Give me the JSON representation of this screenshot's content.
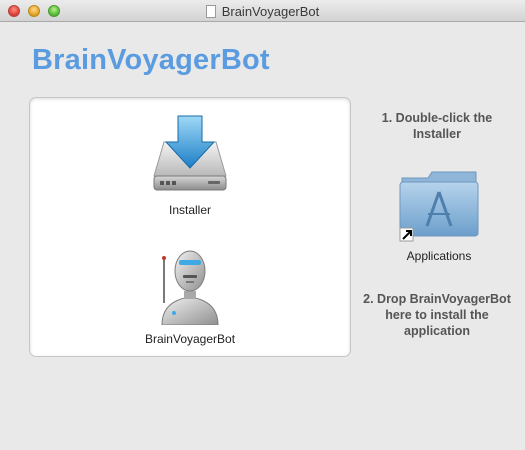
{
  "window": {
    "title": "BrainVoyagerBot"
  },
  "heading": "BrainVoyagerBot",
  "panel": {
    "items": [
      {
        "label": "Installer",
        "icon": "installer-drive-icon"
      },
      {
        "label": "BrainVoyagerBot",
        "icon": "robot-icon"
      }
    ]
  },
  "instructions": {
    "step1": "1. Double-click the Installer",
    "step2": "2. Drop BrainVoyagerBot here to install the application"
  },
  "applications": {
    "label": "Applications",
    "icon": "applications-folder-icon"
  },
  "colors": {
    "heading": "#5b9be0",
    "background": "#e9e9e9",
    "panel": "#ffffff"
  }
}
